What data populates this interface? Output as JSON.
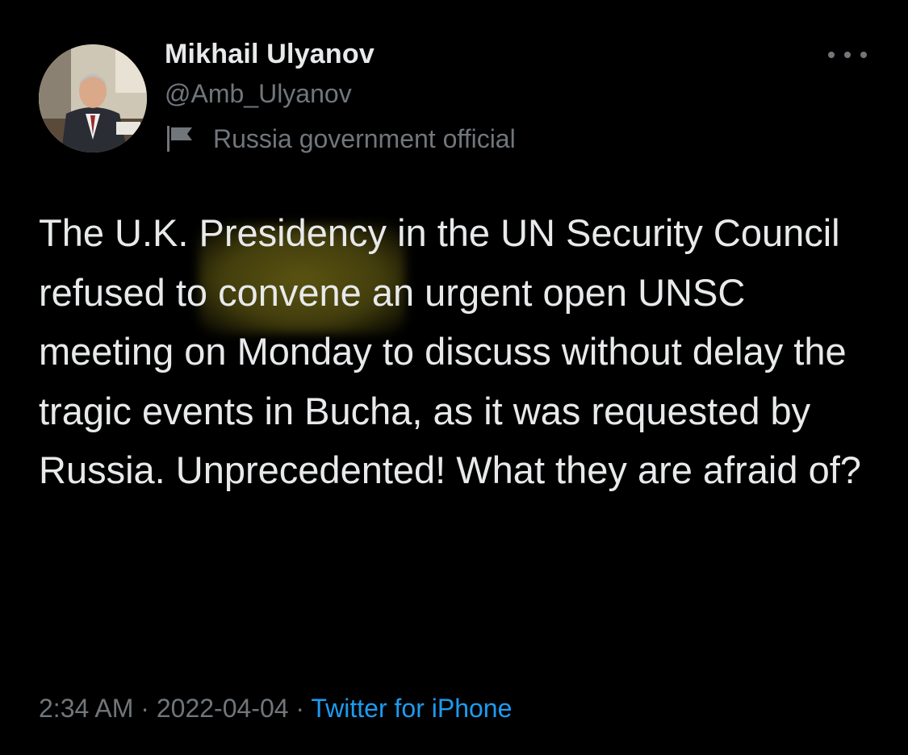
{
  "tweet": {
    "author": {
      "name": "Mikhail Ulyanov",
      "handle": "@Amb_Ulyanov",
      "label": "Russia government official"
    },
    "text": "The U.K. Presidency in the UN Security Council refused to convene an urgent open UNSC meeting on Monday to discuss without delay the tragic events in Bucha, as it was requested by Russia. Unprecedented! What they are afraid of?",
    "highlighted_word": "refused",
    "meta": {
      "time": "2:34 AM",
      "separator": " · ",
      "date": "2022-04-04",
      "source": "Twitter for iPhone"
    },
    "colors": {
      "background": "#000000",
      "primary_text": "#e7e9ea",
      "secondary_text": "#71767b",
      "link": "#1d9bf0",
      "highlight": "#5f5812"
    },
    "icons": {
      "more": "more-horizontal-icon",
      "label": "flag-icon"
    }
  }
}
